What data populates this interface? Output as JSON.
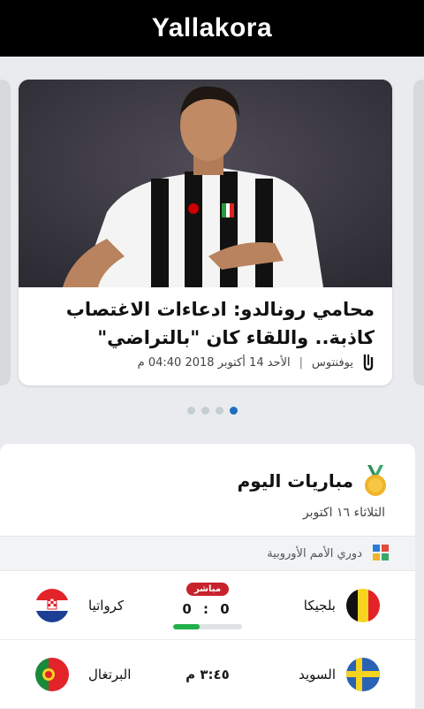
{
  "app": {
    "logo_text": "Yallakora"
  },
  "news": {
    "title": "محامي رونالدو: ادعاءات الاغتصاب كاذبة.. واللقاء كان \"بالتراضي\"",
    "club": "يوفنتوس",
    "datetime": "الأحد 14 أكتوبر 2018 04:40 م",
    "separator": "|",
    "image_icon": "player-photo",
    "club_icon": "juventus-logo-icon"
  },
  "carousel": {
    "slide_count": 4,
    "active_index": 3
  },
  "matches": {
    "title": "مباريات اليوم",
    "date": "الثلاثاء ١٦ اكتوبر",
    "title_icon": "medal-icon",
    "league": {
      "name": "دوري الأمم الأوروبية",
      "icon": "nations-league-icon"
    },
    "games": [
      {
        "home": "بلجيكا",
        "away": "كرواتيا",
        "status": "مباشر",
        "score": "0 : 0",
        "progress": 0.38
      },
      {
        "home": "السويد",
        "away": "البرتغال",
        "time": "٣:٤٥ م"
      }
    ]
  },
  "colors": {
    "live": "#c8232c",
    "progress": "#22b04b",
    "active_dot": "#1e6fbf",
    "topbar": "#000000"
  }
}
